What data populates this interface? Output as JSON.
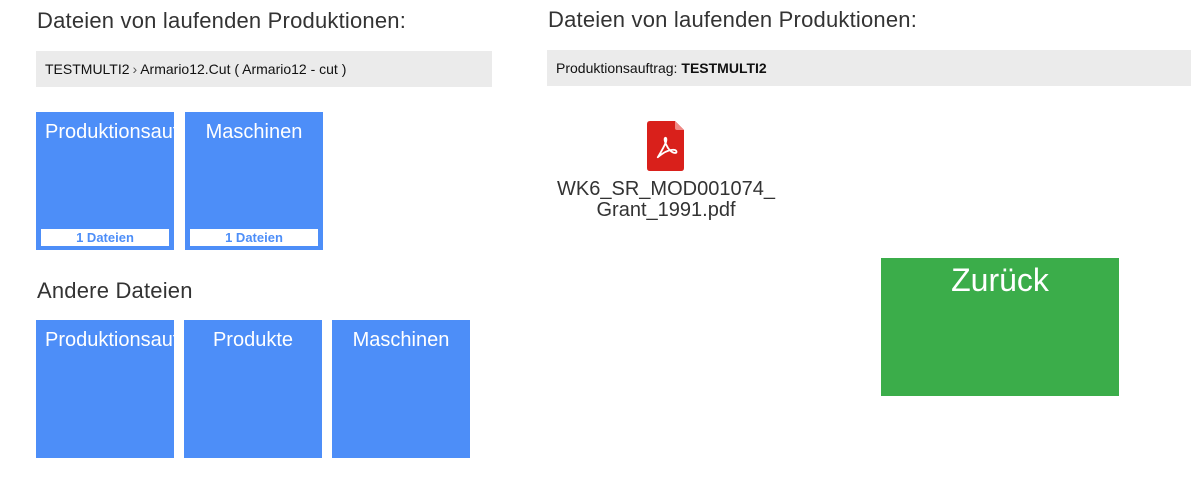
{
  "left_panel": {
    "heading": "Dateien von laufenden Produktionen:",
    "breadcrumb": {
      "order": "TESTMULTI2",
      "separator": "›",
      "item": "Armario12.Cut ( Armario12 - cut )"
    },
    "tiles": [
      {
        "label": "Produktionsauftrag",
        "count": "1 Dateien"
      },
      {
        "label": "Maschinen",
        "count": "1 Dateien"
      }
    ],
    "other_heading": "Andere Dateien",
    "other_tiles": [
      {
        "label": "Produktionsauftrag"
      },
      {
        "label": "Produkte"
      },
      {
        "label": "Maschinen"
      }
    ]
  },
  "right_panel": {
    "heading": "Dateien von laufenden Produktionen:",
    "order_bar": {
      "label": "Produktionsauftrag:",
      "value": "TESTMULTI2"
    },
    "files": [
      {
        "name_line1": "WK6_SR_MOD001074_",
        "name_line2": "Grant_1991.pdf",
        "icon": "pdf-icon"
      }
    ],
    "back_button": "Zurück"
  },
  "colors": {
    "tile_blue": "#4d8ef8",
    "back_green": "#3bad4a",
    "pdf_red": "#d9201b",
    "bar_gray": "#ebebeb"
  }
}
